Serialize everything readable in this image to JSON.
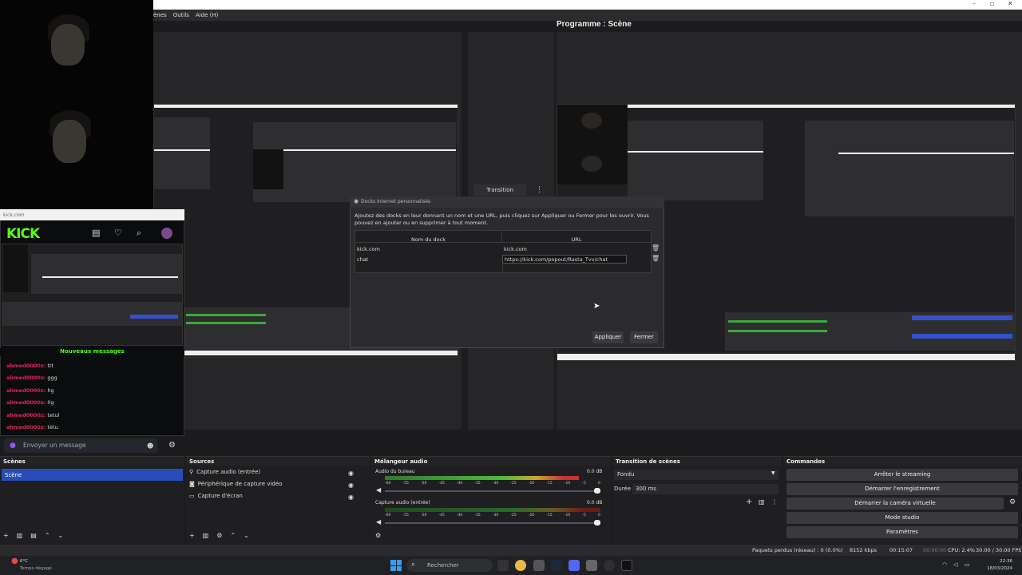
{
  "menubar": {
    "items": [
      "ènes",
      "Outils",
      "Aide (H)"
    ]
  },
  "program_title": "Programme : Scène",
  "transition_mid": {
    "label": "Transition",
    "more_icon": "⋮"
  },
  "kick": {
    "url": "kick.com",
    "logo": "KICK",
    "new_messages": "Nouveaux messages",
    "messages": [
      {
        "user": "ahmed0000z:",
        "text": "ttt"
      },
      {
        "user": "ahmed0000z:",
        "text": "ggg"
      },
      {
        "user": "ahmed0000z:",
        "text": "hg"
      },
      {
        "user": "ahmed0000z:",
        "text": "0g"
      },
      {
        "user": "ahmed0000z:",
        "text": "tetul"
      },
      {
        "user": "ahmed0000z:",
        "text": "tètu"
      }
    ],
    "input_placeholder": "Envoyer un message"
  },
  "dialog": {
    "title": "Docks Internet personnalisés",
    "description": "Ajoutez des docks en leur donnant un nom et une URL, puis cliquez sur Appliquer ou Fermer pour les ouvrir. Vous pouvez en ajouter ou en supprimer à tout moment.",
    "col_name": "Nom du dock",
    "col_url": "URL",
    "rows": [
      {
        "name": "kick.com",
        "url": "kick.com"
      },
      {
        "name": "chat",
        "url": "https://kick.com/popout/Rasta_Tvv/chat"
      }
    ],
    "apply": "Appliquer",
    "close": "Fermer"
  },
  "scenes": {
    "title": "Scènes",
    "items": [
      "Scène"
    ]
  },
  "sources": {
    "title": "Sources",
    "items": [
      "Capture audio (entrée)",
      "Périphérique de capture vidéo",
      "Capture d'écran"
    ]
  },
  "mixer": {
    "title": "Mélangeur audio",
    "channels": [
      {
        "name": "Audio du bureau",
        "db": "0.0 dB",
        "level": 0.9
      },
      {
        "name": "Capture audio (entrée)",
        "db": "0.0 dB",
        "level": 0.0
      }
    ],
    "ticks": [
      "-60",
      "-55",
      "-50",
      "-45",
      "-40",
      "-35",
      "-30",
      "-25",
      "-20",
      "-15",
      "-10",
      "-5",
      "0"
    ]
  },
  "transitions": {
    "title": "Transition de scènes",
    "type": "Fondu",
    "duration_label": "Durée",
    "duration": "300 ms"
  },
  "commands": {
    "title": "Commandes",
    "buttons": [
      "Arrêter le streaming",
      "Démarrer l'enregistrement",
      "Démarrer la caméra virtuelle",
      "Mode studio",
      "Paramètres"
    ]
  },
  "status": {
    "dropped": "Paquets perdus (réseau) : 0 (0.0%)",
    "bitrate": "8152 kbps",
    "stream_time": "00:15:07",
    "rec_time": "00:00:00",
    "cpu": "CPU: 2.4%",
    "fps": "30.00 / 30.00 FPS"
  },
  "taskbar": {
    "weather_temp": "6°C",
    "weather_desc": "Temps dégagé",
    "search_placeholder": "Rechercher",
    "time": "22:36",
    "date": "18/03/2024"
  },
  "colors": {
    "accent": "#284cb8",
    "kick_green": "#53fc18"
  }
}
